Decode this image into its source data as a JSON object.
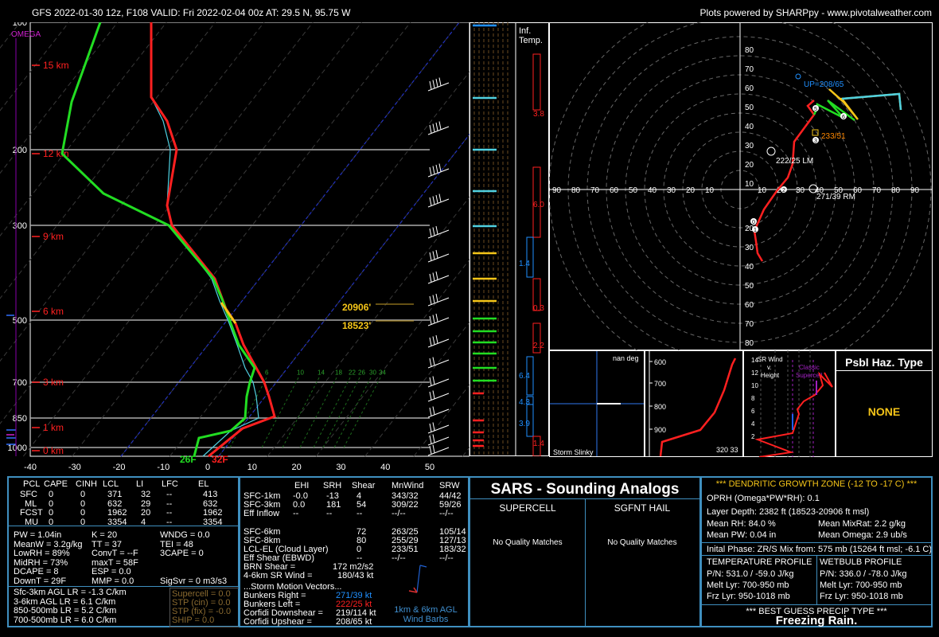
{
  "header": {
    "left": "GFS 2022-01-30 12z, F108  VALID: Fri 2022-02-04 00z  AT: 29.5 N, 95.75 W",
    "right": "Plots powered by SHARPpy - www.pivotalweather.com"
  },
  "skewt": {
    "pressure_ticks": [
      "100",
      "200",
      "300",
      "500",
      "700",
      "850",
      "1000"
    ],
    "temp_ticks": [
      "-40",
      "-30",
      "-20",
      "-10",
      "0",
      "10",
      "20",
      "30",
      "40",
      "50"
    ],
    "height_labels": [
      "15 km",
      "12 km",
      "9 km",
      "6 km",
      "3 km",
      "1 km",
      "0 km"
    ],
    "omega_label": "OMEGA",
    "mixing_ratio_labels": [
      "6",
      "10",
      "14",
      "18",
      "22",
      "26",
      "30",
      "34"
    ],
    "dgz_labels": [
      "20906'",
      "18523'"
    ],
    "surface_labels": {
      "dewpoint": "26F",
      "temp": "32F"
    }
  },
  "inf_temp": {
    "title": "Inf.\nTemp.",
    "values": [
      "3.8",
      "6.0",
      "1.4",
      "0.3",
      "2.2",
      "6.4",
      "4.3",
      "3.9",
      "1.4"
    ]
  },
  "hodograph": {
    "axis_labels": [
      "80",
      "70",
      "60",
      "50",
      "40",
      "30",
      "20",
      "10"
    ],
    "ring_labels_left": [
      "90",
      "80",
      "70",
      "60",
      "50",
      "40",
      "30",
      "20",
      "10"
    ],
    "ring_labels_right": [
      "10",
      "20",
      "30",
      "40",
      "50",
      "60",
      "70",
      "80",
      "90"
    ],
    "annotations": {
      "up": "UP=208/65",
      "mean": "233/51",
      "lm": "222/25 LM",
      "rm": "271/39 RM"
    },
    "points": [
      "5",
      "6",
      "3",
      "2",
      "0",
      "1"
    ]
  },
  "storm_slinky": {
    "title": "nan deg",
    "label": "Storm Slinky"
  },
  "theta": {
    "levels": [
      "600",
      "700",
      "800",
      "900"
    ],
    "values": "320 33"
  },
  "srwind": {
    "title": "SR Wind\nv.\nHeight",
    "classic": "Classic\nSupercell",
    "levels": [
      "14",
      "12",
      "10",
      "8",
      "6",
      "4",
      "2"
    ]
  },
  "hazard": {
    "title": "Psbl Haz. Type",
    "value": "NONE"
  },
  "parcels": {
    "headers": [
      "PCL",
      "CAPE",
      "CINH",
      "LCL",
      "LI",
      "LFC",
      "EL"
    ],
    "rows": [
      [
        "SFC",
        "0",
        "0",
        "371",
        "32",
        "--",
        "413"
      ],
      [
        "ML",
        "0",
        "0",
        "632",
        "29",
        "--",
        "632"
      ],
      [
        "FCST",
        "0",
        "0",
        "1962",
        "20",
        "--",
        "1962"
      ],
      [
        "MU",
        "0",
        "0",
        "3354",
        "4",
        "--",
        "3354"
      ]
    ]
  },
  "indices": {
    "left": [
      "PW = 1.04in",
      "MeanW = 3.2g/kg",
      "LowRH = 89%",
      "MidRH = 73%",
      "DCAPE = 8",
      "DownT = 29F"
    ],
    "mid": [
      "K = 20",
      "TT = 37",
      "ConvT = --F",
      "maxT = 58F",
      "ESP = 0.0",
      "MMP = 0.0"
    ],
    "right": [
      "WNDG = 0.0",
      "TEI = 48",
      "3CAPE = 0",
      "",
      "",
      ""
    ],
    "sigsvr": "SigSvr = 0 m3/s3",
    "lapse": [
      "Sfc-3km AGL LR = -1.3 C/km",
      "3-6km AGL LR = 6.1 C/km",
      "850-500mb LR = 5.2 C/km",
      "700-500mb LR = 6.0 C/km"
    ],
    "composite": [
      "Supercell = 0.0",
      "STP (cin) = 0.0",
      "STP (fix) = -0.0",
      "SHIP = 0.0"
    ]
  },
  "kinematics": {
    "headers": [
      "EHI",
      "SRH",
      "Shear",
      "MnWind",
      "SRW"
    ],
    "rows": [
      [
        "SFC-1km",
        "-0.0",
        "-13",
        "4",
        "343/32",
        "44/42"
      ],
      [
        "SFC-3km",
        "0.0",
        "181",
        "54",
        "309/22",
        "59/26"
      ],
      [
        "Eff Inflow",
        "--",
        "--",
        "--",
        "--/--",
        "--/--"
      ],
      [
        "",
        "",
        "",
        "",
        "",
        ""
      ],
      [
        "SFC-6km",
        "",
        "",
        "72",
        "263/25",
        "105/14"
      ],
      [
        "SFC-8km",
        "",
        "",
        "80",
        "255/29",
        "127/13"
      ],
      [
        "LCL-EL (Cloud Layer)",
        "",
        "",
        "0",
        "233/51",
        "183/32"
      ],
      [
        "Eff Shear (EBWD)",
        "",
        "",
        "--",
        "--/--",
        "--/--"
      ]
    ],
    "brn": [
      "BRN Shear =",
      "172 m2/s2"
    ],
    "srwind46": [
      "4-6km SR Wind =",
      "180/43 kt"
    ],
    "storm_motion_title": "...Storm Motion Vectors...",
    "storm_motion": [
      [
        "Bunkers Right =",
        "271/39 kt"
      ],
      [
        "Bunkers Left =",
        "222/25 kt"
      ],
      [
        "Corfidi Downshear =",
        "219/114 kt"
      ],
      [
        "Corfidi Upshear =",
        "208/65 kt"
      ]
    ],
    "barb_caption": "1km & 6km AGL\nWind Barbs"
  },
  "sars": {
    "title": "SARS - Sounding Analogs",
    "supercell": "SUPERCELL",
    "hail": "SGFNT HAIL",
    "no_match": "No Quality Matches"
  },
  "dgz": {
    "title": "*** DENDRITIC GROWTH ZONE (-12 TO -17 C) ***",
    "oprh": "OPRH (Omega*PW*RH): 0.1",
    "layer_depth": "Layer Depth: 2382 ft (18523-20906 ft msl)",
    "mean_rh": "Mean RH: 84.0 %",
    "mean_mixrat": "Mean MixRat: 2.2 g/kg",
    "mean_pw": "Mean PW: 0.04 in",
    "mean_omega": "Mean Omega: 2.9 ub/s",
    "initial_phase": "Inital Phase: ZR/S Mix from: 575 mb (15264 ft msl; -6.1 C)",
    "temp_profile": [
      "TEMPERATURE PROFILE",
      "P/N: 531.0 / -59.0 J/kg",
      "Melt Lyr: 700-950 mb",
      "Frz Lyr: 950-1018 mb"
    ],
    "wetbulb_profile": [
      "WETBULB PROFILE",
      "P/N: 336.0 / -78.0 J/kg",
      "Melt Lyr: 700-950 mb",
      "Frz Lyr: 950-1018 mb"
    ],
    "precip_title": "*** BEST GUESS PRECIP TYPE ***",
    "precip_value": "Freezing Rain."
  },
  "colors": {
    "temp": "#ff2020",
    "dewpoint": "#22dd22",
    "wetbulb": "#4fd0e0",
    "border": "#3f8fbf",
    "dgz": "#f5c518",
    "text": "#ffffff"
  },
  "chart_data": {
    "type": "line",
    "title": "",
    "xlabel": "",
    "ylabel": "",
    "ylim": [
      1050,
      100
    ],
    "xlim": [
      -40,
      50
    ],
    "series": [
      {
        "x": [
          30.2,
          13.5,
          10.8,
          9.3,
          7.6,
          6.3,
          5.1,
          1.6,
          -3.1,
          -7.7,
          -13.7,
          -22.2,
          -31.7,
          -41.9,
          -54.1,
          -59.0,
          -58.0,
          -60.5
        ],
        "y": [
          1000,
          950,
          900,
          850,
          800,
          750,
          700,
          650,
          600,
          550,
          500,
          450,
          400,
          350,
          300,
          250,
          200,
          150
        ]
      },
      {
        "x": [
          26.1,
          5.2,
          4.9,
          4.2,
          2.9,
          2.6,
          1.8,
          -1.2,
          -4.5,
          -9.3,
          -16.6,
          -24.6,
          -39.4,
          -51.4,
          -63.8,
          -76.7,
          -85.7,
          -92.0
        ],
        "y": [
          1000,
          950,
          900,
          850,
          800,
          750,
          700,
          650,
          600,
          550,
          500,
          450,
          400,
          350,
          300,
          250,
          200,
          150
        ]
      }
    ]
  }
}
